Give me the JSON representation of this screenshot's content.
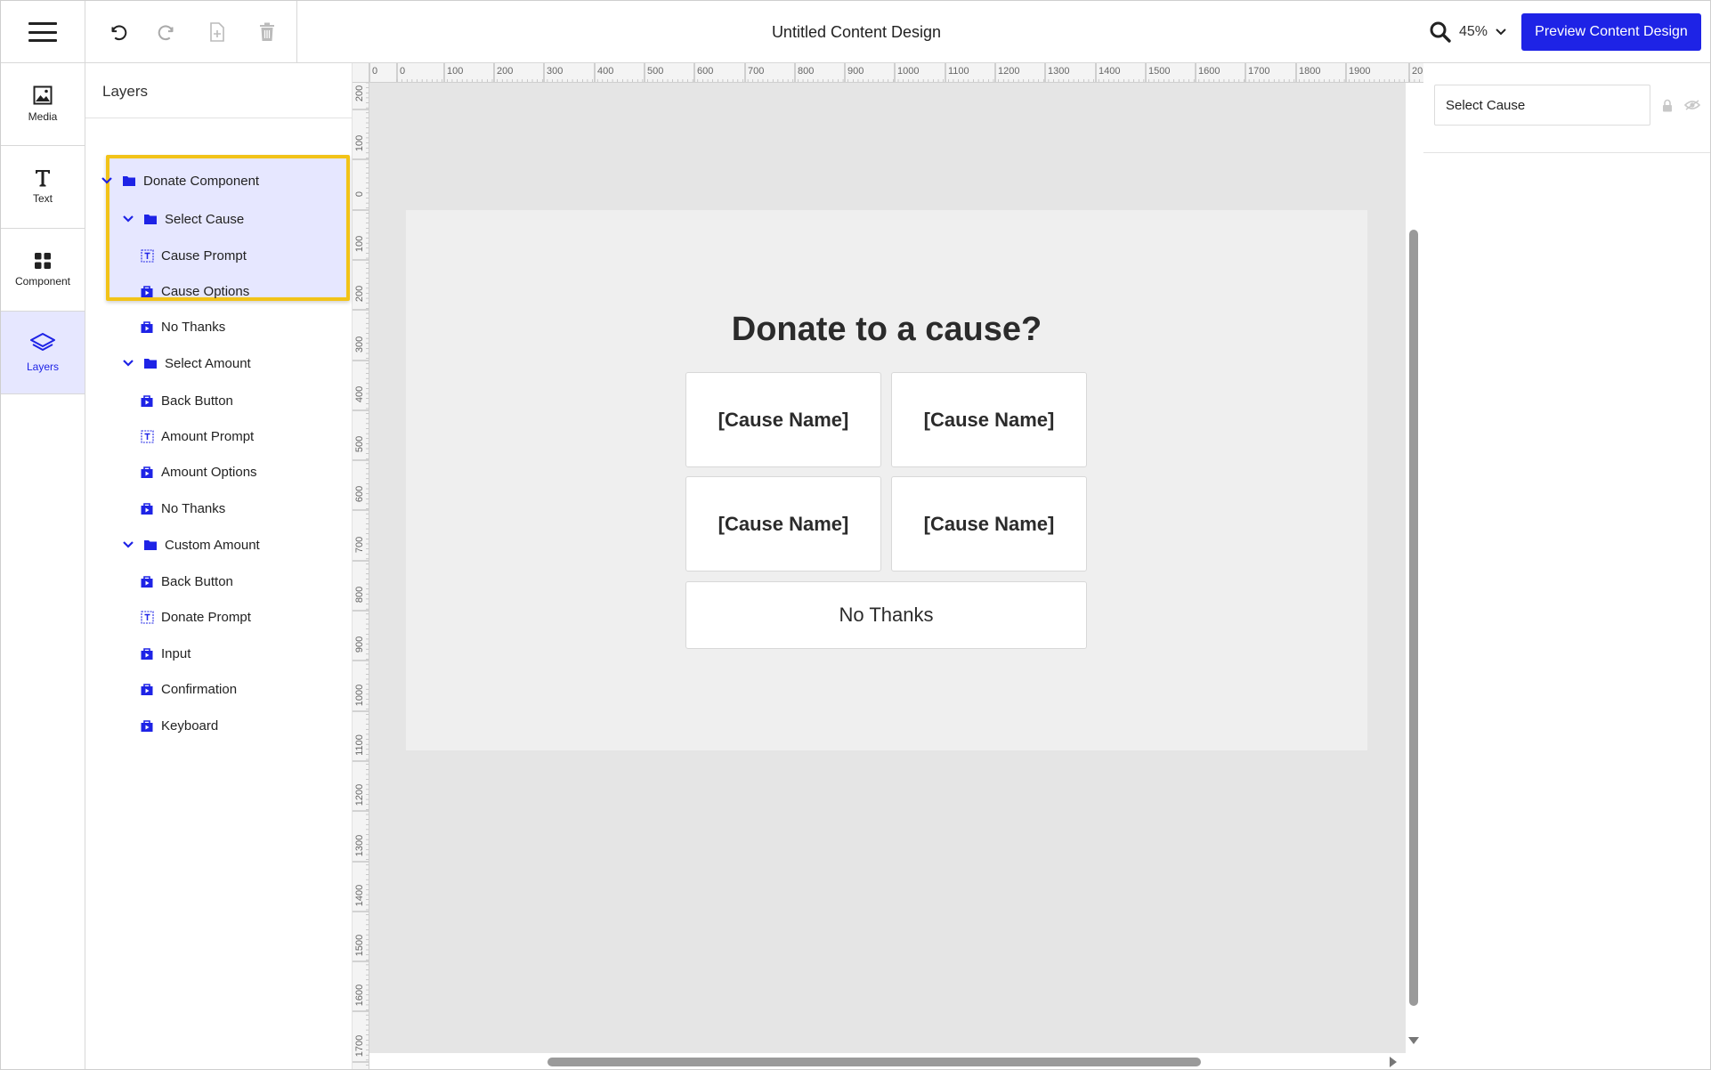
{
  "document": {
    "title": "Untitled Content Design"
  },
  "zoom": {
    "value": "45%"
  },
  "preview_button": {
    "label": "Preview Content Design"
  },
  "colors": {
    "accent": "#1e23e6",
    "highlight": "#f2c318",
    "selected_bg": "#e6e7ff"
  },
  "rail": {
    "items": [
      {
        "label": "Media",
        "icon": "image-icon"
      },
      {
        "label": "Text",
        "icon": "text-icon"
      },
      {
        "label": "Component",
        "icon": "grid-icon"
      },
      {
        "label": "Layers",
        "icon": "layers-icon",
        "active": true
      }
    ]
  },
  "layers": {
    "title": "Layers",
    "tree": [
      {
        "label": "Donate Component",
        "type": "folder",
        "level": 0
      },
      {
        "label": "Select Cause",
        "type": "folder",
        "level": 1,
        "selected": true
      },
      {
        "label": "Cause Prompt",
        "type": "text",
        "level": 2,
        "selected": true
      },
      {
        "label": "Cause Options",
        "type": "component",
        "level": 2,
        "selected": true
      },
      {
        "label": "No Thanks",
        "type": "component",
        "level": 2,
        "selected": true
      },
      {
        "label": "Select Amount",
        "type": "folder",
        "level": 1
      },
      {
        "label": "Back Button",
        "type": "component",
        "level": 2
      },
      {
        "label": "Amount Prompt",
        "type": "text",
        "level": 2
      },
      {
        "label": "Amount Options",
        "type": "component",
        "level": 2
      },
      {
        "label": "No Thanks",
        "type": "component",
        "level": 2
      },
      {
        "label": "Custom Amount",
        "type": "folder",
        "level": 1
      },
      {
        "label": "Back Button",
        "type": "component",
        "level": 2
      },
      {
        "label": "Donate Prompt",
        "type": "text",
        "level": 2
      },
      {
        "label": "Input",
        "type": "component",
        "level": 2
      },
      {
        "label": "Confirmation",
        "type": "component",
        "level": 2
      },
      {
        "label": "Keyboard",
        "type": "component",
        "level": 2
      }
    ]
  },
  "rulers": {
    "top_labels": [
      "0",
      "0",
      "100",
      "200",
      "300",
      "400",
      "500",
      "600",
      "700",
      "800",
      "900",
      "1000",
      "1100",
      "1200",
      "1300",
      "1400",
      "1500",
      "1600",
      "1700",
      "1800",
      "1900",
      "20"
    ],
    "left_labels": [
      "200",
      "100",
      "0",
      "100",
      "200",
      "300",
      "400",
      "500",
      "600",
      "700",
      "800",
      "900",
      "1000",
      "1100",
      "1200",
      "1300",
      "1400",
      "1500",
      "1600",
      "1700"
    ]
  },
  "artboard": {
    "title": "Donate to a cause?",
    "causes": [
      "[Cause Name]",
      "[Cause Name]",
      "[Cause Name]",
      "[Cause Name]"
    ],
    "no_thanks": "No Thanks"
  },
  "properties": {
    "layer_name": "Select Cause"
  }
}
